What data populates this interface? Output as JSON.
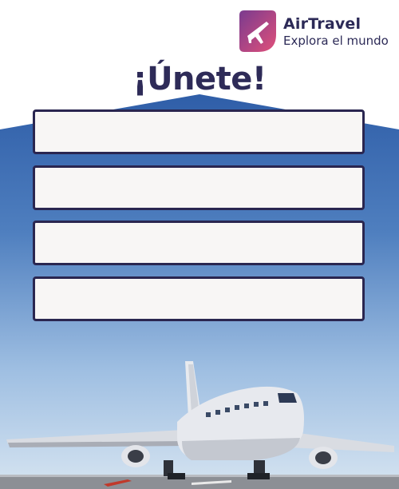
{
  "brand": {
    "name": "AirTravel",
    "tagline": "Explora el mundo",
    "icon": "airplane-icon",
    "badge_colors": [
      "#7a3b8f",
      "#e0507a"
    ]
  },
  "title": "¡Únete!",
  "form": {
    "fields": [
      {
        "value": "",
        "placeholder": ""
      },
      {
        "value": "",
        "placeholder": ""
      },
      {
        "value": "",
        "placeholder": ""
      },
      {
        "value": "",
        "placeholder": ""
      }
    ]
  },
  "colors": {
    "text_dark": "#2c2a57",
    "sky_top": "#2f5ea8",
    "sky_bottom": "#cfe0f1",
    "field_border": "#2a2650",
    "field_fill": "#f8f6f5"
  },
  "background": {
    "image": "pixel-airplane-on-runway"
  }
}
